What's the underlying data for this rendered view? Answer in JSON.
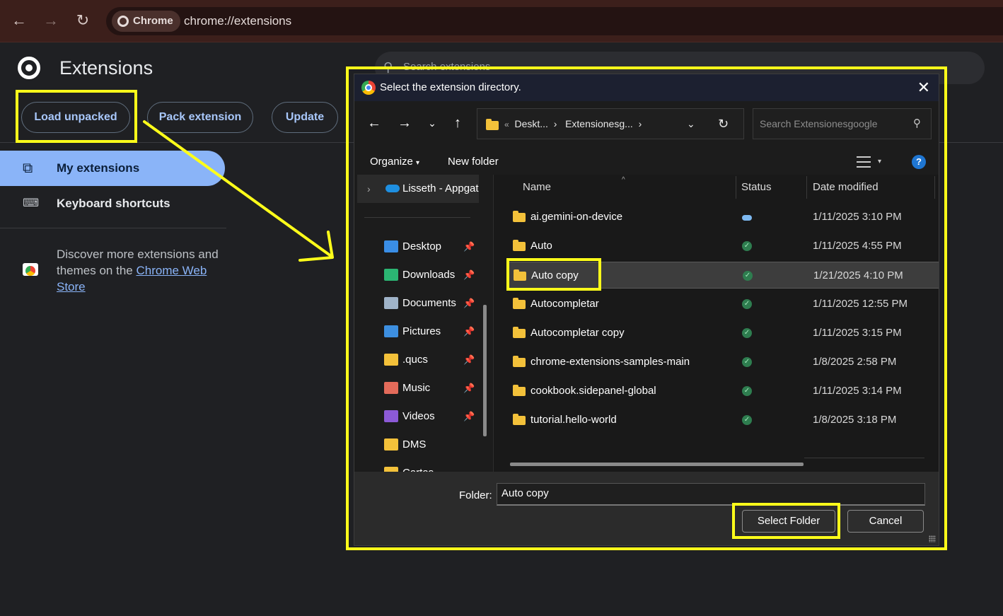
{
  "browser": {
    "chip_label": "Chrome",
    "url": "chrome://extensions"
  },
  "extensions_page": {
    "title": "Extensions",
    "search_placeholder": "Search extensions",
    "buttons": {
      "load_unpacked": "Load unpacked",
      "pack_extension": "Pack extension",
      "update": "Update"
    },
    "sidebar": {
      "items": [
        {
          "label": "My extensions",
          "icon": "puzzle-icon"
        },
        {
          "label": "Keyboard shortcuts",
          "icon": "keyboard-icon"
        }
      ],
      "discover_text": "Discover more extensions and themes on the ",
      "discover_link": "Chrome Web Store"
    }
  },
  "dialog": {
    "title": "Select the extension directory.",
    "path_crumbs": [
      "Deskt...",
      "Extensionesg..."
    ],
    "path_prefix": "«",
    "search_placeholder": "Search Extensionesgoogle",
    "toolbar": {
      "organize": "Organize",
      "new_folder": "New folder"
    },
    "nav": {
      "onedrive": "Lisseth - Appgat",
      "items": [
        {
          "label": "Desktop",
          "pinned": true,
          "color": "#3a8ee6"
        },
        {
          "label": "Downloads",
          "pinned": true,
          "color": "#2bb673"
        },
        {
          "label": "Documents",
          "pinned": true,
          "color": "#9fb3c8"
        },
        {
          "label": "Pictures",
          "pinned": true,
          "color": "#3d8fe0"
        },
        {
          "label": ".qucs",
          "pinned": true,
          "color": "#f3c13a"
        },
        {
          "label": "Music",
          "pinned": true,
          "color": "#e36b5a"
        },
        {
          "label": "Videos",
          "pinned": true,
          "color": "#8c5ad6"
        },
        {
          "label": "DMS",
          "pinned": false,
          "color": "#f3c13a"
        },
        {
          "label": "Cartas",
          "pinned": false,
          "color": "#f3c13a"
        }
      ]
    },
    "columns": {
      "name": "Name",
      "status": "Status",
      "date": "Date modified"
    },
    "files": [
      {
        "name": "ai.gemini-on-device",
        "status": "cloud",
        "date": "1/11/2025 3:10 PM"
      },
      {
        "name": "Auto",
        "status": "synced",
        "date": "1/11/2025 4:55 PM"
      },
      {
        "name": "Auto copy",
        "status": "synced",
        "date": "1/21/2025 4:10 PM",
        "selected": true
      },
      {
        "name": "Autocompletar",
        "status": "synced",
        "date": "1/11/2025 12:55 PM"
      },
      {
        "name": "Autocompletar copy",
        "status": "synced",
        "date": "1/11/2025 3:15 PM"
      },
      {
        "name": "chrome-extensions-samples-main",
        "status": "synced",
        "date": "1/8/2025 2:58 PM"
      },
      {
        "name": "cookbook.sidepanel-global",
        "status": "synced",
        "date": "1/11/2025 3:14 PM"
      },
      {
        "name": "tutorial.hello-world",
        "status": "synced",
        "date": "1/8/2025 3:18 PM"
      }
    ],
    "folder_label": "Folder:",
    "folder_value": "Auto copy",
    "select_button": "Select Folder",
    "cancel_button": "Cancel"
  },
  "colors": {
    "highlight": "#ffff1a",
    "accent": "#8ab4f8",
    "dialog_bg": "#191919"
  }
}
